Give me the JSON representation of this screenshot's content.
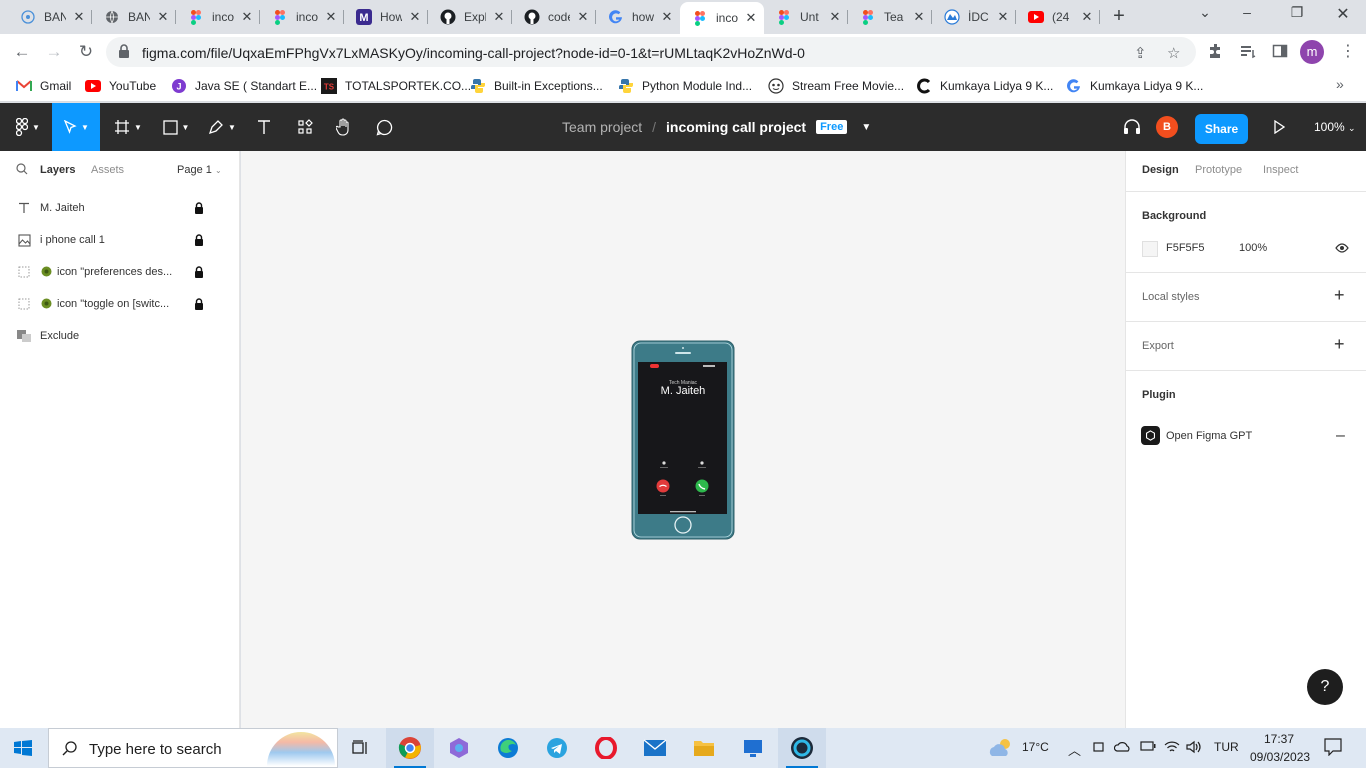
{
  "browser": {
    "tabs": [
      {
        "title": "BAN",
        "icon": "edge-globe-icon",
        "active": false
      },
      {
        "title": "BAN",
        "icon": "globe-icon",
        "active": false
      },
      {
        "title": "inco",
        "icon": "figma-icon",
        "active": false
      },
      {
        "title": "inco",
        "icon": "figma-icon",
        "active": false
      },
      {
        "title": "How",
        "icon": "m-icon",
        "active": false
      },
      {
        "title": "Expl",
        "icon": "github-icon",
        "active": false
      },
      {
        "title": "code",
        "icon": "github-icon",
        "active": false
      },
      {
        "title": "how",
        "icon": "google-icon",
        "active": false
      },
      {
        "title": "inco",
        "icon": "figma-icon",
        "active": true
      },
      {
        "title": "Unt",
        "icon": "figma-icon",
        "active": false
      },
      {
        "title": "Tea",
        "icon": "figma-icon",
        "active": false
      },
      {
        "title": "İDC",
        "icon": "idc-icon",
        "active": false
      },
      {
        "title": "(24",
        "icon": "youtube-icon",
        "active": false
      }
    ],
    "url": "figma.com/file/UqxaEmFPhgVx7LxMASKyOy/incoming-call-project?node-id=0-1&t=rUMLtaqK2vHoZnWd-0",
    "bookmarks": [
      {
        "label": "Gmail",
        "icon": "gmail-icon"
      },
      {
        "label": "YouTube",
        "icon": "youtube-icon"
      },
      {
        "label": "Java SE ( Standart E...",
        "icon": "java-icon"
      },
      {
        "label": "TOTALSPORTEK.CO...",
        "icon": "ts-icon"
      },
      {
        "label": "Built-in Exceptions...",
        "icon": "python-icon"
      },
      {
        "label": "Python Module Ind...",
        "icon": "python-icon"
      },
      {
        "label": "Stream Free Movie...",
        "icon": "movie-icon"
      },
      {
        "label": "Kumkaya Lidya 9 K...",
        "icon": "c-icon"
      },
      {
        "label": "Kumkaya Lidya 9 K...",
        "icon": "google-icon"
      }
    ],
    "profile_initial": "m"
  },
  "figma": {
    "team": "Team project",
    "separator": "/",
    "project": "incoming call project",
    "plan_badge": "Free",
    "user_initial": "B",
    "share_label": "Share",
    "zoom": "100%",
    "left_panel": {
      "tabs": [
        "Layers",
        "Assets"
      ],
      "page": "Page 1",
      "layers": [
        {
          "name": "M. Jaiteh",
          "icon": "text-layer-icon",
          "locked": true
        },
        {
          "name": "i phone call 1",
          "icon": "image-layer-icon",
          "locked": true
        },
        {
          "name": "icon \"preferences des...",
          "icon": "component-layer-icon",
          "locked": true
        },
        {
          "name": "icon \"toggle on [switc...",
          "icon": "component-layer-icon",
          "locked": true
        },
        {
          "name": "Exclude",
          "icon": "boolean-layer-icon",
          "locked": false
        }
      ]
    },
    "right_panel": {
      "tabs": [
        "Design",
        "Prototype",
        "Inspect"
      ],
      "background_title": "Background",
      "background_hex": "F5F5F5",
      "background_opacity": "100%",
      "local_styles": "Local styles",
      "export": "Export",
      "plugin_title": "Plugin",
      "plugin_name": "Open Figma GPT",
      "help": "?"
    },
    "phone": {
      "caller_sub": "Tech Maniac",
      "caller_name": "M. Jaiteh",
      "frame_color": "#3d7b88"
    }
  },
  "taskbar": {
    "search_placeholder": "Type here to search",
    "weather": "17°C",
    "language": "TUR",
    "time": "17:37",
    "date": "09/03/2023"
  }
}
